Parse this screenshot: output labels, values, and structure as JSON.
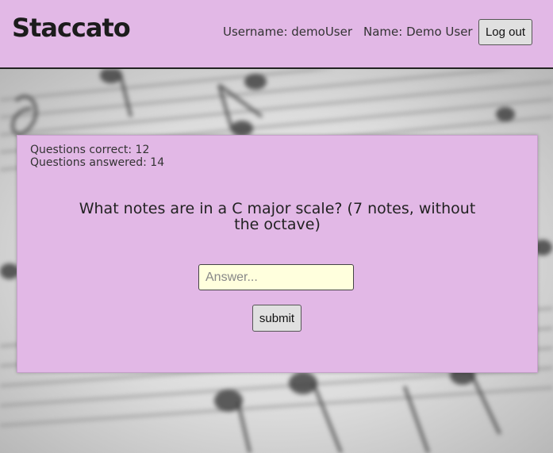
{
  "header": {
    "brand": "Staccato",
    "username": "Username: demoUser",
    "name": "Name: Demo User",
    "logout_label": "Log out"
  },
  "quiz": {
    "correct": "Questions correct: 12",
    "answered": "Questions answered: 14",
    "question": "What notes are in a C major scale? (7 notes, without the octave)",
    "answer_placeholder": "Answer...",
    "submit_label": "submit"
  },
  "colors": {
    "accent": "#e2b8e6",
    "input_bg": "#ffffdd"
  }
}
